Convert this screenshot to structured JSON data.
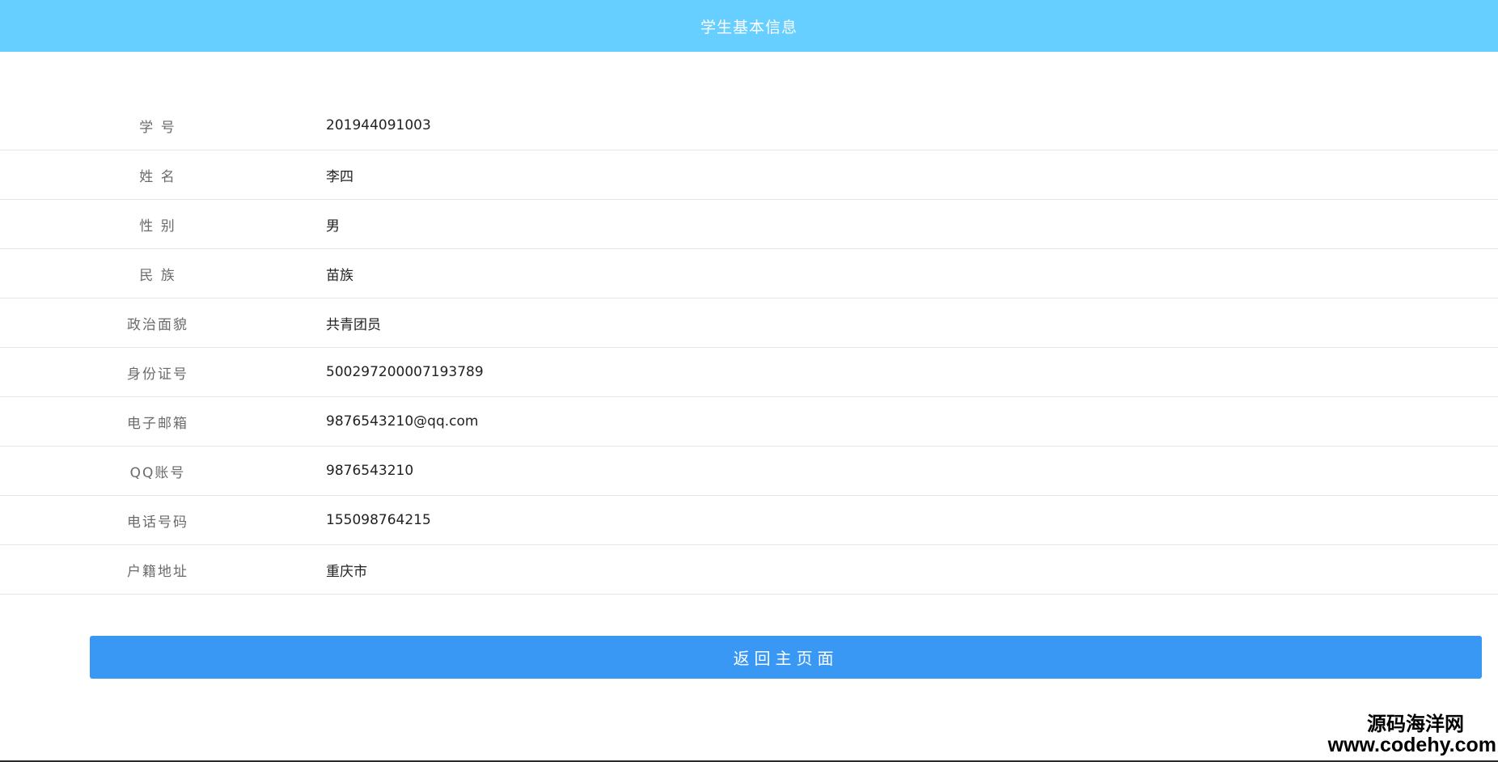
{
  "header": {
    "title": "学生基本信息"
  },
  "fields": [
    {
      "label": "学 号",
      "value": "201944091003"
    },
    {
      "label": "姓 名",
      "value": "李四"
    },
    {
      "label": "性 别",
      "value": "男"
    },
    {
      "label": "民 族",
      "value": "苗族"
    },
    {
      "label": "政治面貌",
      "value": "共青团员"
    },
    {
      "label": "身份证号",
      "value": "500297200007193789"
    },
    {
      "label": "电子邮箱",
      "value": "9876543210@qq.com"
    },
    {
      "label": "QQ账号",
      "value": "9876543210"
    },
    {
      "label": "电话号码",
      "value": "155098764215"
    },
    {
      "label": "户籍地址",
      "value": "重庆市"
    }
  ],
  "actions": {
    "back_label": "返回主页面"
  },
  "watermark": {
    "name": "源码海洋网",
    "url": "www.codehy.com"
  },
  "colors": {
    "header_bg": "#66cfff",
    "button_bg": "#3a98f5"
  }
}
